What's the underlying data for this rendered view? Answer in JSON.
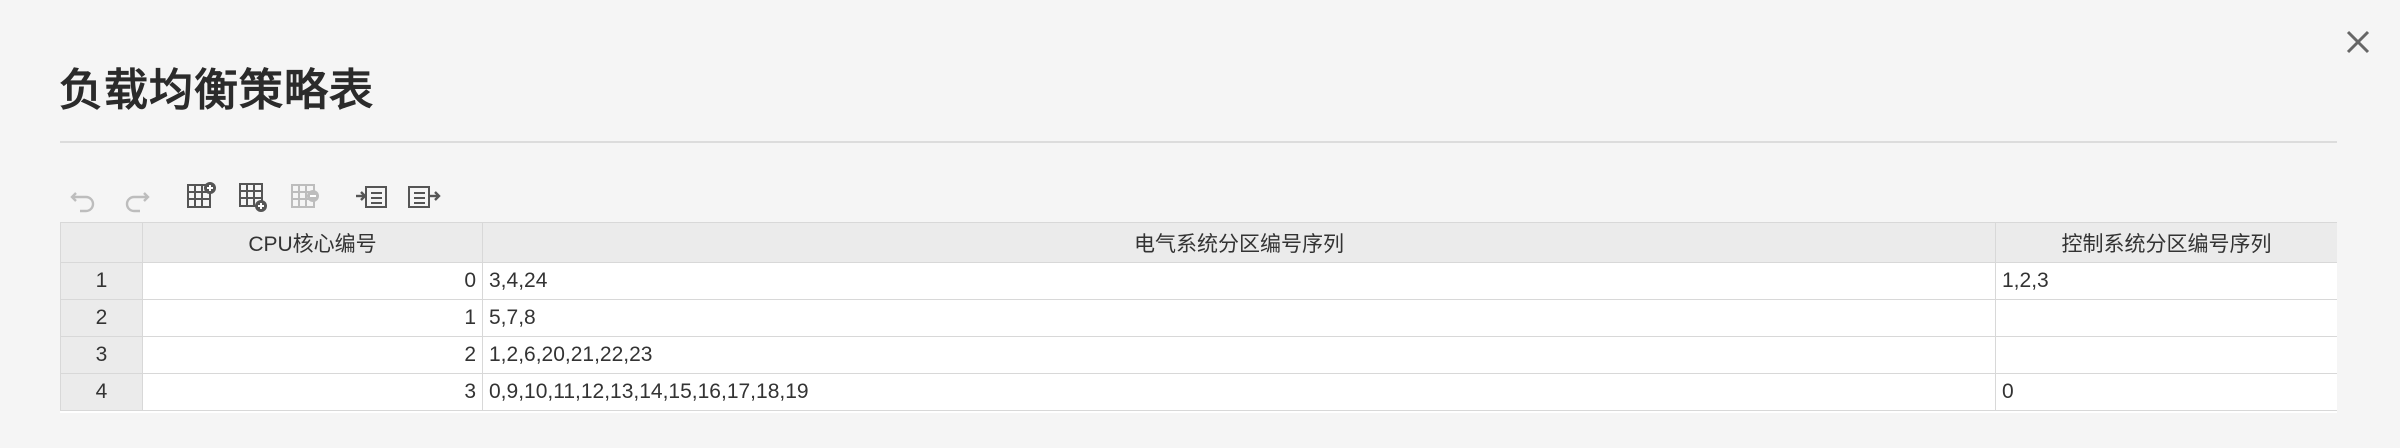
{
  "dialog": {
    "title": "负载均衡策略表"
  },
  "toolbar": {
    "items": [
      {
        "name": "undo-icon",
        "enabled": false
      },
      {
        "name": "redo-icon",
        "enabled": false
      },
      {
        "name": "insert-column-icon",
        "enabled": true
      },
      {
        "name": "insert-row-icon",
        "enabled": true
      },
      {
        "name": "delete-column-icon",
        "enabled": false
      },
      {
        "name": "indent-icon",
        "enabled": true
      },
      {
        "name": "outdent-icon",
        "enabled": true
      }
    ]
  },
  "table": {
    "columns": [
      "CPU核心编号",
      "电气系统分区编号序列",
      "控制系统分区编号序列"
    ],
    "rows": [
      {
        "index": "1",
        "cpu": "0",
        "elec": "3,4,24",
        "ctrl": "1,2,3"
      },
      {
        "index": "2",
        "cpu": "1",
        "elec": "5,7,8",
        "ctrl": ""
      },
      {
        "index": "3",
        "cpu": "2",
        "elec": "1,2,6,20,21,22,23",
        "ctrl": ""
      },
      {
        "index": "4",
        "cpu": "3",
        "elec": "0,9,10,11,12,13,14,15,16,17,18,19",
        "ctrl": "0"
      }
    ]
  },
  "colors": {
    "background": "#f5f5f5",
    "header_bg": "#ebebeb",
    "grid_line": "#d8d8d8",
    "icon_enabled": "#555555",
    "icon_disabled": "#bdbdbd"
  }
}
